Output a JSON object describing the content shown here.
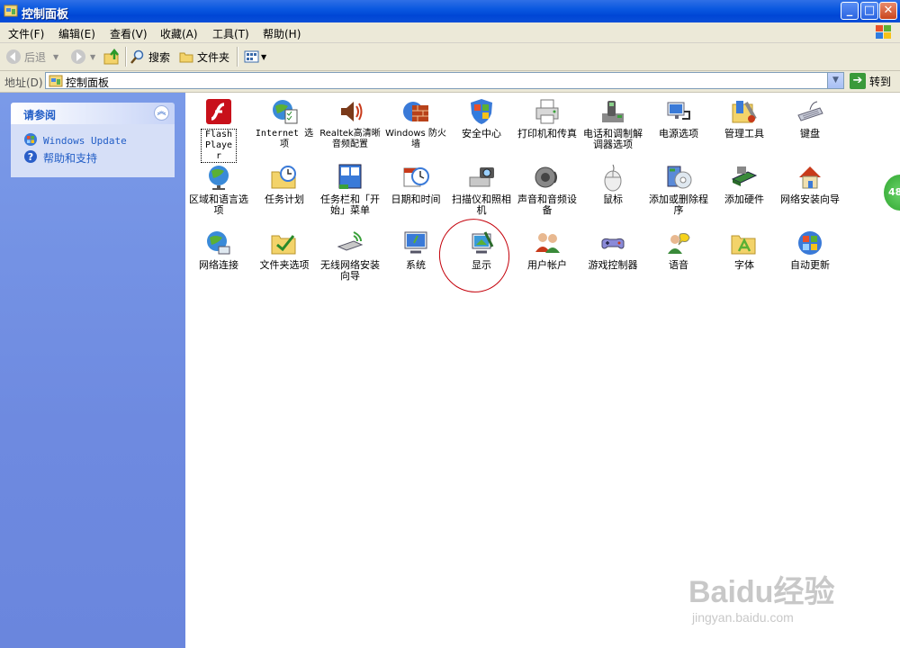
{
  "window": {
    "title": "控制面板"
  },
  "menu": [
    "文件(F)",
    "编辑(E)",
    "查看(V)",
    "收藏(A)",
    "工具(T)",
    "帮助(H)"
  ],
  "toolbar": {
    "back_label": "后退",
    "search_label": "搜索",
    "folders_label": "文件夹"
  },
  "address": {
    "label": "地址(D)",
    "value": "控制面板",
    "go_label": "转到"
  },
  "see_also": {
    "title": "请参阅",
    "links": [
      {
        "label": "Windows Update",
        "icon": "windows-update-icon"
      },
      {
        "label": "帮助和支持",
        "icon": "help-icon"
      }
    ]
  },
  "items": [
    {
      "label": "Flash Player",
      "icon": "flash-icon"
    },
    {
      "label": "Internet 选项",
      "icon": "internet-options-icon"
    },
    {
      "label": "Realtek高清晰音频配置",
      "icon": "speaker-icon"
    },
    {
      "label": "Windows 防火墙",
      "icon": "firewall-icon"
    },
    {
      "label": "安全中心",
      "icon": "shield-icon"
    },
    {
      "label": "打印机和传真",
      "icon": "printer-icon"
    },
    {
      "label": "电话和调制解调器选项",
      "icon": "phone-icon"
    },
    {
      "label": "电源选项",
      "icon": "power-icon"
    },
    {
      "label": "管理工具",
      "icon": "tools-icon"
    },
    {
      "label": "键盘",
      "icon": "keyboard-icon"
    },
    {
      "label": "区域和语言选项",
      "icon": "globe-icon"
    },
    {
      "label": "任务计划",
      "icon": "scheduled-tasks-icon"
    },
    {
      "label": "任务栏和「开始」菜单",
      "icon": "taskbar-icon"
    },
    {
      "label": "日期和时间",
      "icon": "clock-icon"
    },
    {
      "label": "扫描仪和照相机",
      "icon": "scanner-icon"
    },
    {
      "label": "声音和音频设备",
      "icon": "sound-icon"
    },
    {
      "label": "鼠标",
      "icon": "mouse-icon"
    },
    {
      "label": "添加或删除程序",
      "icon": "add-remove-icon"
    },
    {
      "label": "添加硬件",
      "icon": "hardware-icon"
    },
    {
      "label": "网络安装向导",
      "icon": "home-network-icon"
    },
    {
      "label": "网络连接",
      "icon": "network-icon"
    },
    {
      "label": "文件夹选项",
      "icon": "folder-options-icon"
    },
    {
      "label": "无线网络安装向导",
      "icon": "wireless-icon"
    },
    {
      "label": "系统",
      "icon": "system-icon"
    },
    {
      "label": "显示",
      "icon": "display-icon"
    },
    {
      "label": "用户帐户",
      "icon": "users-icon"
    },
    {
      "label": "游戏控制器",
      "icon": "gamepad-icon"
    },
    {
      "label": "语音",
      "icon": "speech-icon"
    },
    {
      "label": "字体",
      "icon": "fonts-icon"
    },
    {
      "label": "自动更新",
      "icon": "auto-update-icon"
    }
  ],
  "badge": "48",
  "watermark": {
    "brand": "Baidu经验",
    "url": "jingyan.baidu.com"
  },
  "colors": {
    "titlebar": "#0a58e0",
    "sidebar": "#7a9ae8",
    "link": "#215dc6",
    "annotation": "#c4000a"
  }
}
